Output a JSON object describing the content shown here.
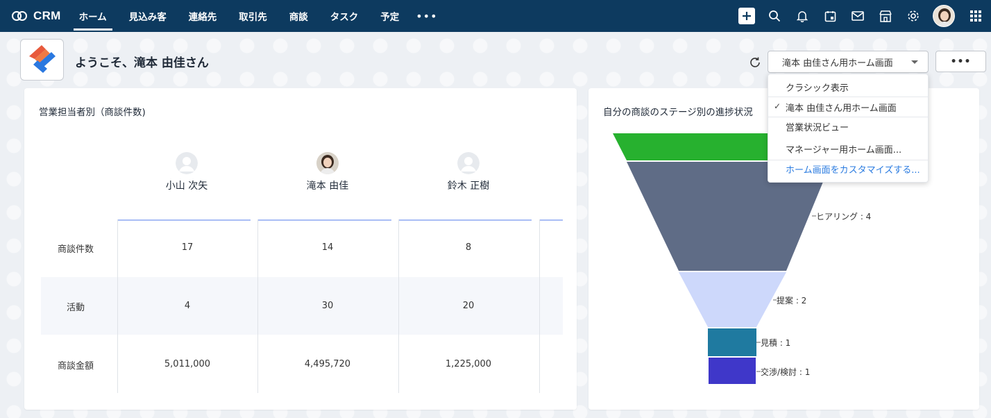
{
  "app": {
    "name": "CRM"
  },
  "nav": {
    "items": [
      "ホーム",
      "見込み客",
      "連絡先",
      "取引先",
      "商談",
      "タスク",
      "予定"
    ],
    "active_index": 0,
    "more": "•••"
  },
  "header": {
    "welcome": "ようこそ、滝本 由佳さん",
    "view_select": "滝本 由佳さん用ホーム画面",
    "more_label": "•••"
  },
  "colors": {
    "topbar": "#0d3a5f",
    "accent_line": "#a9bdf5",
    "link": "#2a7be0"
  },
  "dropdown": {
    "items": [
      {
        "label": "クラシック表示",
        "checked": false
      },
      {
        "label": "滝本 由佳さん用ホーム画面",
        "checked": true
      },
      {
        "label": "営業状況ビュー",
        "checked": false
      },
      {
        "label": "マネージャー用ホーム画面...",
        "checked": false
      },
      {
        "label": "ホーム画面をカスタマイズする...",
        "checked": false,
        "link": true
      }
    ]
  },
  "rep_card": {
    "title": "営業担当者別（商談件数)",
    "reps": [
      "小山 次矢",
      "滝本 由佳",
      "鈴木 正樹"
    ],
    "rows": [
      {
        "label": "商談件数",
        "values": [
          "17",
          "14",
          "8"
        ]
      },
      {
        "label": "活動",
        "values": [
          "4",
          "30",
          "20"
        ]
      },
      {
        "label": "商談金額",
        "values": [
          "5,011,000",
          "4,495,720",
          "1,225,000"
        ]
      }
    ]
  },
  "funnel_card": {
    "title": "自分の商談のステージ別の進捗状況",
    "labels": [
      "ヒアリング : 4",
      "提案 : 2",
      "見積 : 1",
      "交渉/検討 : 1"
    ]
  },
  "chart_data": {
    "type": "funnel",
    "title": "自分の商談のステージ別の進捗状況",
    "stages": [
      {
        "name": "",
        "value": null,
        "color": "#27b12f"
      },
      {
        "name": "ヒアリング",
        "value": 4,
        "color": "#5f6c86"
      },
      {
        "name": "提案",
        "value": 2,
        "color": "#cdd8fb"
      },
      {
        "name": "見積",
        "value": 1,
        "color": "#1f7aa0"
      },
      {
        "name": "交渉/検討",
        "value": 1,
        "color": "#3f37c9"
      }
    ]
  }
}
